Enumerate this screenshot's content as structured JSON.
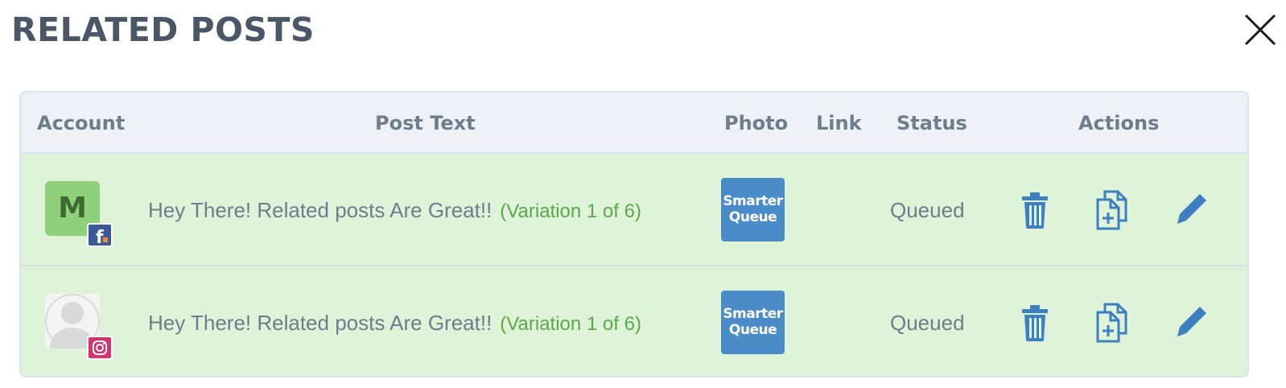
{
  "modal": {
    "title": "RELATED POSTS"
  },
  "table": {
    "headers": {
      "account": "Account",
      "post_text": "Post Text",
      "photo": "Photo",
      "link": "Link",
      "status": "Status",
      "actions": "Actions"
    },
    "rows": [
      {
        "account_initial": "M",
        "network": "facebook",
        "post_text": "Hey There! Related posts Are Great!!",
        "variation": "(Variation 1 of 6)",
        "photo_line1": "Smarter",
        "photo_line2": "Queue",
        "link": "",
        "status": "Queued"
      },
      {
        "account_initial": "",
        "network": "instagram",
        "post_text": "Hey There! Related posts Are Great!!",
        "variation": "(Variation 1 of 6)",
        "photo_line1": "Smarter",
        "photo_line2": "Queue",
        "link": "",
        "status": "Queued"
      }
    ]
  },
  "icons": {
    "close": "close-icon",
    "delete": "trash-icon",
    "duplicate": "duplicate-icon",
    "edit": "pencil-icon",
    "facebook": "facebook-icon",
    "instagram": "instagram-icon"
  },
  "colors": {
    "title": "#4a5766",
    "row_background": "#dff3d8",
    "header_background": "#eef2f7",
    "action_blue": "#3d7fc1",
    "variation_green": "#5aa84c",
    "facebook": "#3b5998",
    "instagram": "#d6336c"
  }
}
